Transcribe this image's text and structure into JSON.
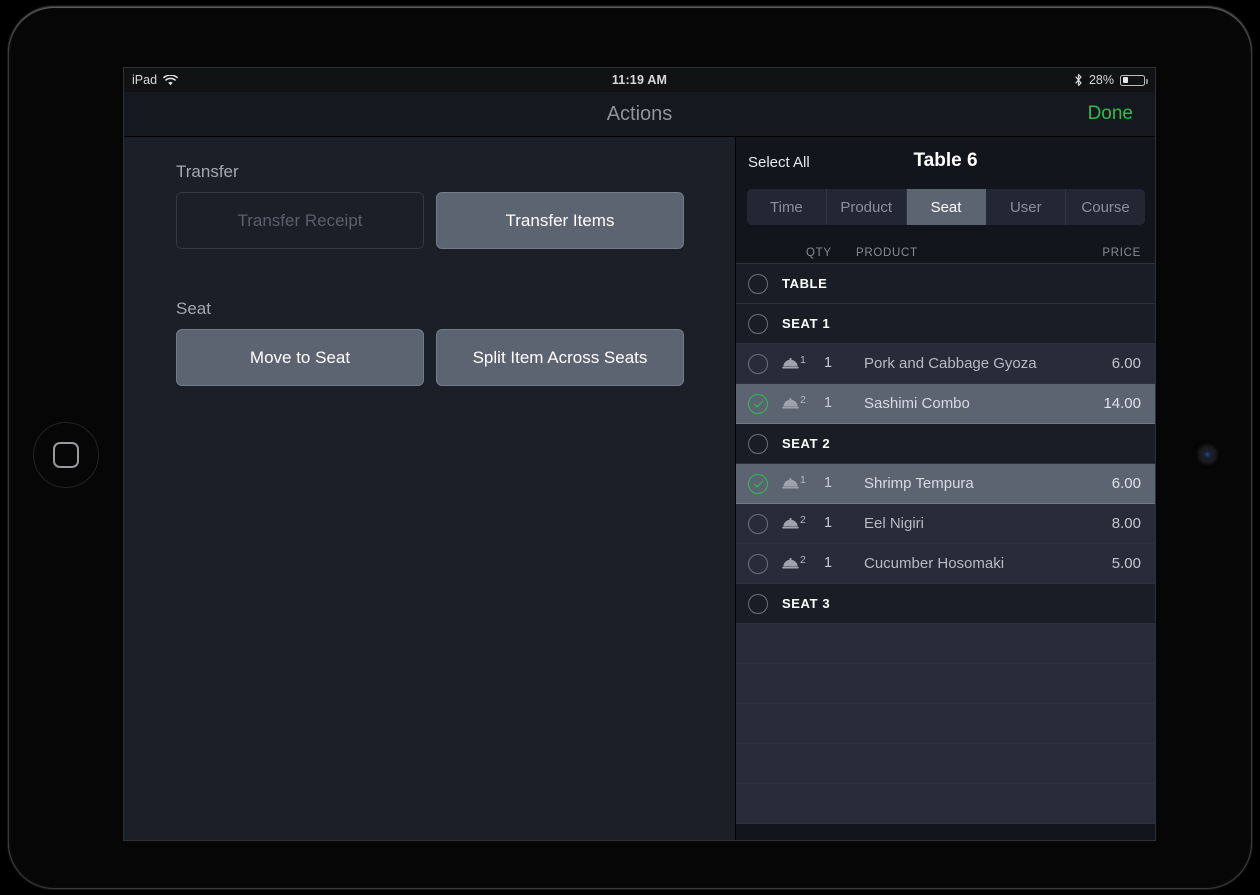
{
  "status_bar": {
    "device_label": "iPad",
    "wifi_icon": "wifi-icon",
    "time": "11:19 AM",
    "bluetooth_icon": "bluetooth-icon",
    "battery_percent": "28%",
    "battery_icon": "battery-icon"
  },
  "nav": {
    "title": "Actions",
    "done_label": "Done"
  },
  "left_panel": {
    "transfer_label": "Transfer",
    "seat_label": "Seat",
    "buttons": [
      {
        "label": "Transfer Receipt",
        "state": "disabled"
      },
      {
        "label": "Transfer Items",
        "state": "enabled"
      },
      {
        "label": "Move to Seat",
        "state": "enabled"
      },
      {
        "label": "Split Item Across Seats",
        "state": "enabled"
      }
    ]
  },
  "right_panel": {
    "select_all_label": "Select All",
    "table_title": "Table 6",
    "segments": [
      {
        "label": "Time",
        "active": false
      },
      {
        "label": "Product",
        "active": false
      },
      {
        "label": "Seat",
        "active": true
      },
      {
        "label": "User",
        "active": false
      },
      {
        "label": "Course",
        "active": false
      }
    ],
    "columns": {
      "qty": "QTY",
      "product": "PRODUCT",
      "price": "PRICE"
    },
    "rows": [
      {
        "kind": "group",
        "label": "TABLE",
        "checked": false
      },
      {
        "kind": "group",
        "label": "SEAT 1",
        "checked": false
      },
      {
        "kind": "item",
        "course": "1",
        "qty": "1",
        "product": "Pork and Cabbage Gyoza",
        "price": "6.00",
        "checked": false
      },
      {
        "kind": "item",
        "course": "2",
        "qty": "1",
        "product": "Sashimi Combo",
        "price": "14.00",
        "checked": true
      },
      {
        "kind": "group",
        "label": "SEAT 2",
        "checked": false
      },
      {
        "kind": "item",
        "course": "1",
        "qty": "1",
        "product": "Shrimp Tempura",
        "price": "6.00",
        "checked": true
      },
      {
        "kind": "item",
        "course": "2",
        "qty": "1",
        "product": "Eel Nigiri",
        "price": "8.00",
        "checked": false
      },
      {
        "kind": "item",
        "course": "2",
        "qty": "1",
        "product": "Cucumber Hosomaki",
        "price": "5.00",
        "checked": false
      },
      {
        "kind": "group",
        "label": "SEAT 3",
        "checked": false
      },
      {
        "kind": "empty"
      },
      {
        "kind": "empty"
      },
      {
        "kind": "empty"
      },
      {
        "kind": "empty"
      },
      {
        "kind": "empty"
      }
    ],
    "course_icon": "cloche-icon"
  },
  "colors": {
    "accent_green": "#2fbd4f",
    "screen_bg": "#1b1f28",
    "panel_bg": "#12151b",
    "row_bg": "#272c38",
    "row_selected_bg": "#5c6471",
    "button_fill": "#5c6471"
  }
}
